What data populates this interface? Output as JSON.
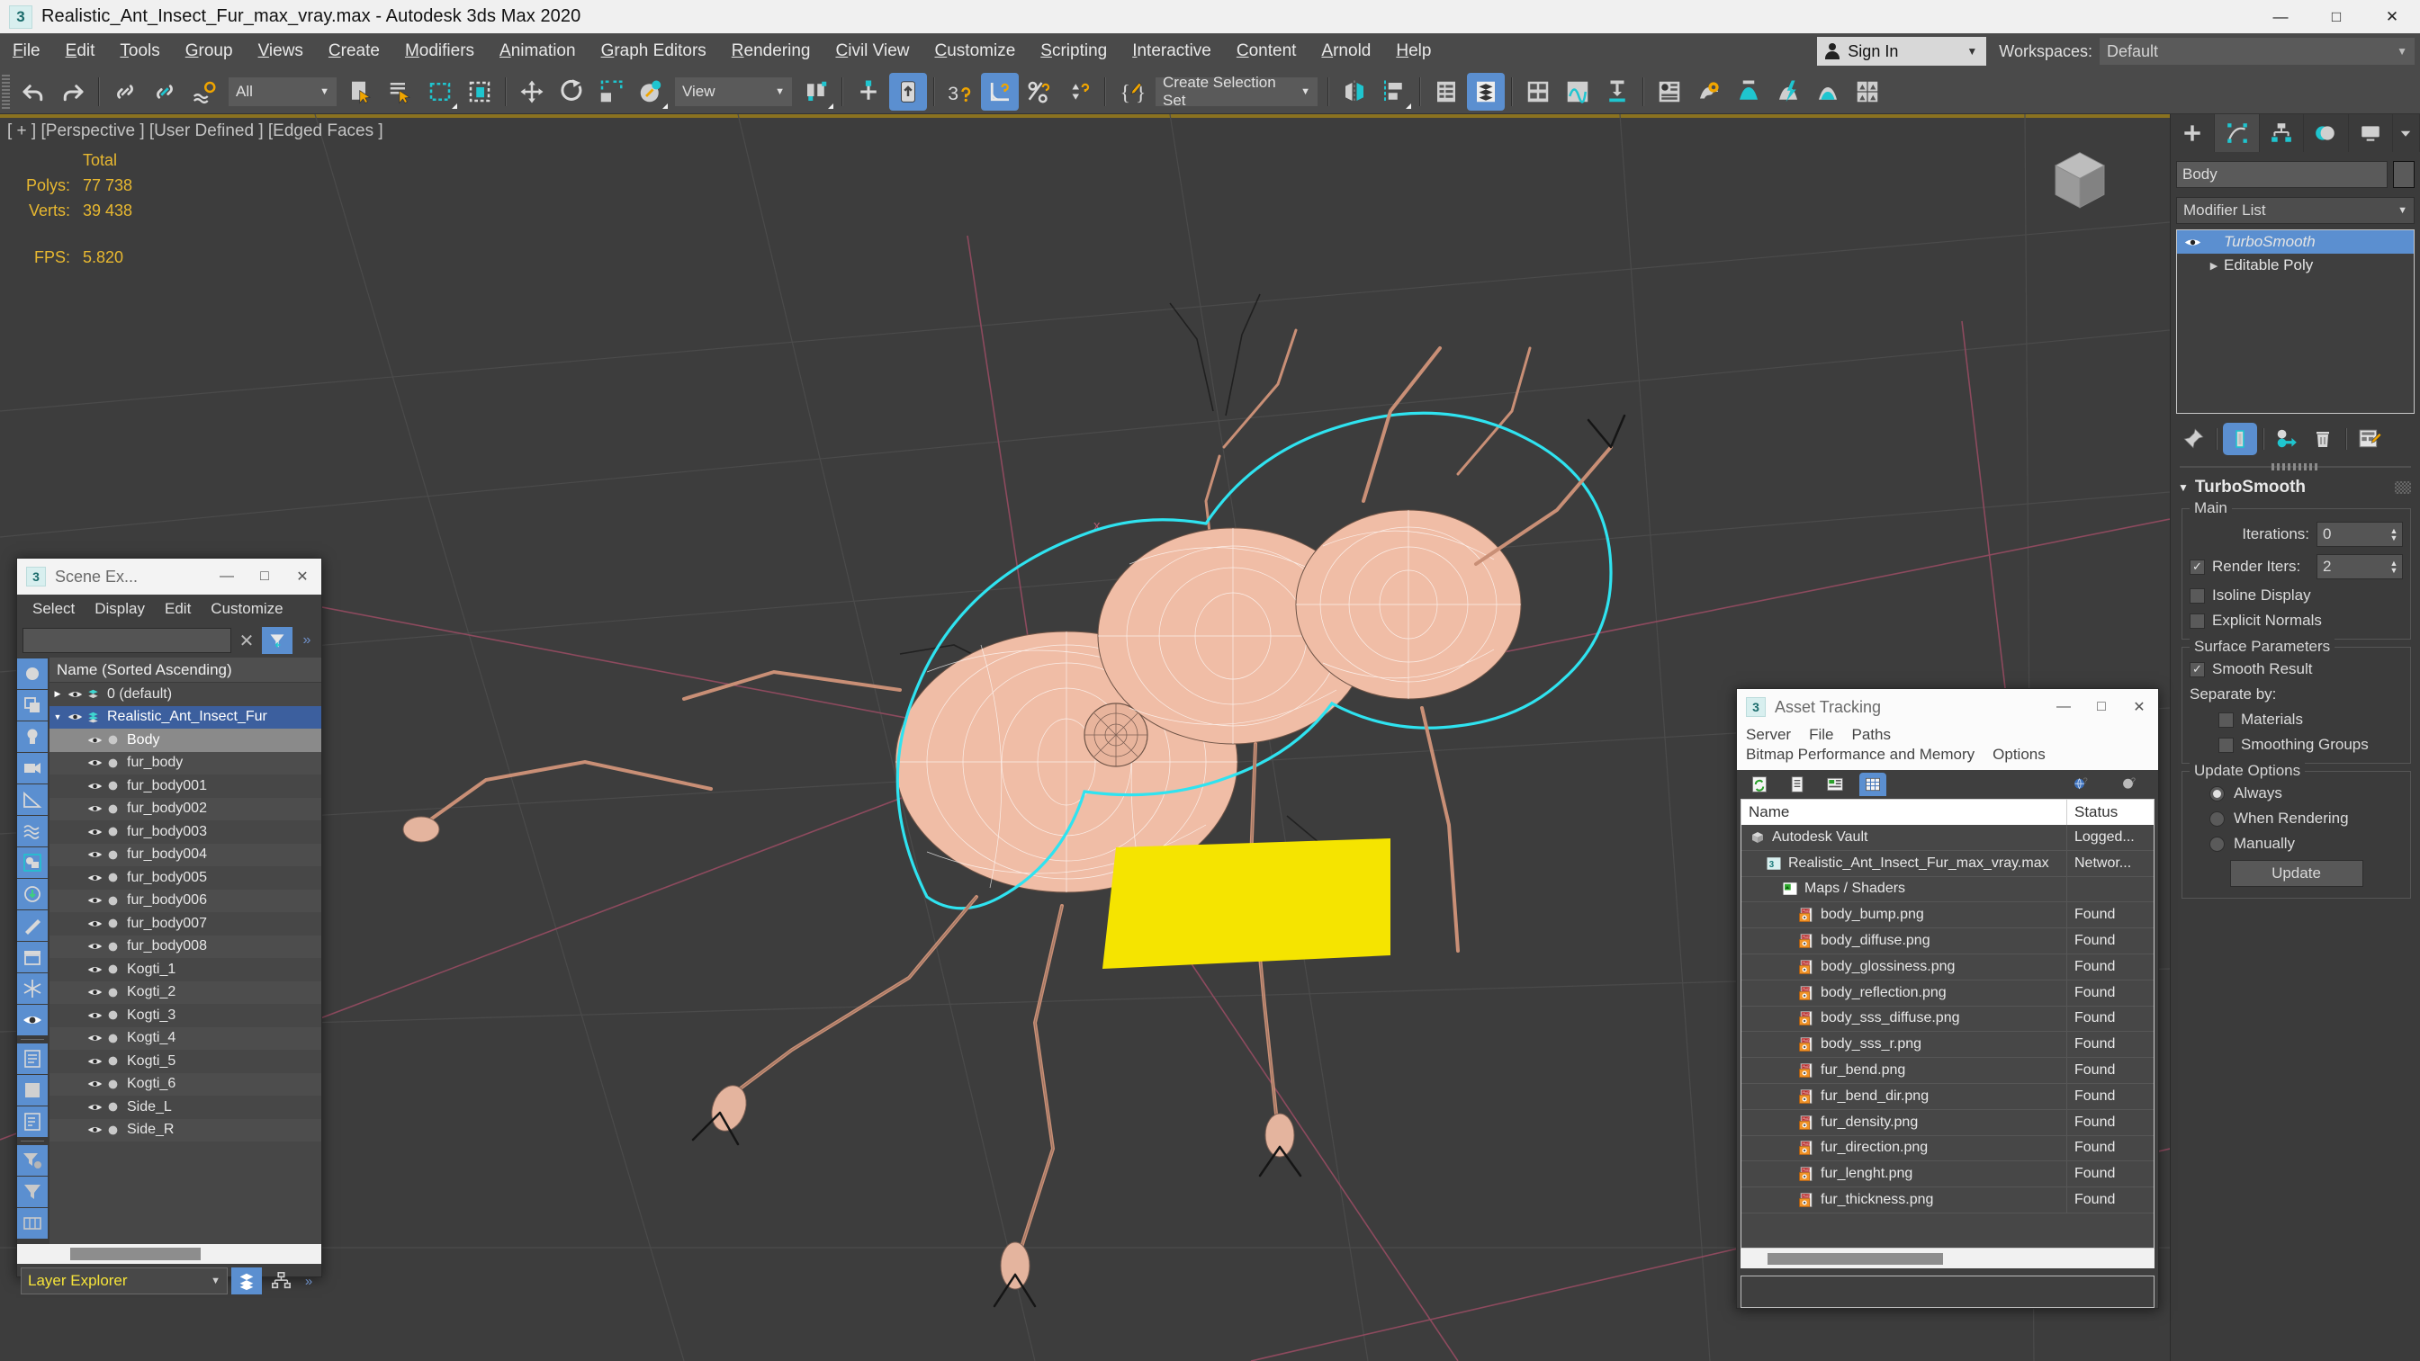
{
  "window": {
    "title": "Realistic_Ant_Insect_Fur_max_vray.max - Autodesk 3ds Max 2020",
    "app_icon": "3dsmax-icon",
    "minimize": "—",
    "maximize": "□",
    "close": "✕"
  },
  "menubar": {
    "items": [
      "File",
      "Edit",
      "Tools",
      "Group",
      "Views",
      "Create",
      "Modifiers",
      "Animation",
      "Graph Editors",
      "Rendering",
      "Civil View",
      "Customize",
      "Scripting",
      "Interactive",
      "Content",
      "Arnold",
      "Help"
    ],
    "sign_in": "Sign In",
    "workspaces_label": "Workspaces:",
    "workspace_value": "Default"
  },
  "toolbar": {
    "selection_filter": "All",
    "reference_coord": "View",
    "selection_set": "Create Selection Set",
    "buttons": [
      "undo",
      "redo",
      "select-link",
      "unlink",
      "bind-spacewarp",
      "selection-filter",
      "select-object",
      "select-by-name",
      "select-region",
      "window-crossing",
      "select-and-move",
      "select-and-rotate",
      "select-and-scale",
      "reference-coordinate",
      "use-pivot-center",
      "snap-toggle",
      "angle-snap",
      "percent-snap",
      "spinner-snap",
      "named-selection-sets",
      "mirror",
      "align",
      "layer-explorer",
      "scene-explorer",
      "curve-editor",
      "schematic-view",
      "render-setup",
      "render-frame-window",
      "render-production",
      "render-iterative",
      "render-in-cloud",
      "material-editor"
    ]
  },
  "viewport": {
    "label": "[ + ] [Perspective ] [User Defined ] [Edged Faces ]",
    "stats": {
      "header": "Total",
      "polys_label": "Polys:",
      "polys_value": "77 738",
      "verts_label": "Verts:",
      "verts_value": "39 438",
      "fps_label": "FPS:",
      "fps_value": "5.820"
    }
  },
  "scene_explorer": {
    "title": "Scene Ex...",
    "menu": [
      "Select",
      "Display",
      "Edit",
      "Customize"
    ],
    "search_value": "",
    "column_header": "Name (Sorted Ascending)",
    "rows": [
      {
        "name": "0 (default)",
        "indent": 0,
        "twisty": "▶",
        "type": "layer",
        "state": "normal"
      },
      {
        "name": "Realistic_Ant_Insect_Fur",
        "indent": 0,
        "twisty": "▼",
        "type": "layer",
        "state": "selected"
      },
      {
        "name": "Body",
        "indent": 1,
        "twisty": "",
        "type": "object",
        "state": "highlight"
      },
      {
        "name": "fur_body",
        "indent": 1,
        "twisty": "",
        "type": "object",
        "state": "normal"
      },
      {
        "name": "fur_body001",
        "indent": 1,
        "twisty": "",
        "type": "object",
        "state": "normal"
      },
      {
        "name": "fur_body002",
        "indent": 1,
        "twisty": "",
        "type": "object",
        "state": "normal"
      },
      {
        "name": "fur_body003",
        "indent": 1,
        "twisty": "",
        "type": "object",
        "state": "normal"
      },
      {
        "name": "fur_body004",
        "indent": 1,
        "twisty": "",
        "type": "object",
        "state": "normal"
      },
      {
        "name": "fur_body005",
        "indent": 1,
        "twisty": "",
        "type": "object",
        "state": "normal"
      },
      {
        "name": "fur_body006",
        "indent": 1,
        "twisty": "",
        "type": "object",
        "state": "normal"
      },
      {
        "name": "fur_body007",
        "indent": 1,
        "twisty": "",
        "type": "object",
        "state": "normal"
      },
      {
        "name": "fur_body008",
        "indent": 1,
        "twisty": "",
        "type": "object",
        "state": "normal"
      },
      {
        "name": "Kogti_1",
        "indent": 1,
        "twisty": "",
        "type": "object",
        "state": "normal"
      },
      {
        "name": "Kogti_2",
        "indent": 1,
        "twisty": "",
        "type": "object",
        "state": "normal"
      },
      {
        "name": "Kogti_3",
        "indent": 1,
        "twisty": "",
        "type": "object",
        "state": "normal"
      },
      {
        "name": "Kogti_4",
        "indent": 1,
        "twisty": "",
        "type": "object",
        "state": "normal"
      },
      {
        "name": "Kogti_5",
        "indent": 1,
        "twisty": "",
        "type": "object",
        "state": "normal"
      },
      {
        "name": "Kogti_6",
        "indent": 1,
        "twisty": "",
        "type": "object",
        "state": "normal"
      },
      {
        "name": "Side_L",
        "indent": 1,
        "twisty": "",
        "type": "object",
        "state": "normal"
      },
      {
        "name": "Side_R",
        "indent": 1,
        "twisty": "",
        "type": "object",
        "state": "normal"
      }
    ],
    "footer_mode": "Layer Explorer"
  },
  "asset_tracking": {
    "title": "Asset Tracking",
    "menu_row1": [
      "Server",
      "File",
      "Paths"
    ],
    "menu_row2": [
      "Bitmap Performance and Memory",
      "Options"
    ],
    "columns": [
      "Name",
      "Status"
    ],
    "rows": [
      {
        "name": "Autodesk Vault",
        "status": "Logged...",
        "indent": 0,
        "icon": "vault-icon"
      },
      {
        "name": "Realistic_Ant_Insect_Fur_max_vray.max",
        "status": "Networ...",
        "indent": 1,
        "icon": "max-file-icon"
      },
      {
        "name": "Maps / Shaders",
        "status": "",
        "indent": 2,
        "icon": "maps-icon"
      },
      {
        "name": "body_bump.png",
        "status": "Found",
        "indent": 3,
        "icon": "png-icon"
      },
      {
        "name": "body_diffuse.png",
        "status": "Found",
        "indent": 3,
        "icon": "png-icon"
      },
      {
        "name": "body_glossiness.png",
        "status": "Found",
        "indent": 3,
        "icon": "png-icon"
      },
      {
        "name": "body_reflection.png",
        "status": "Found",
        "indent": 3,
        "icon": "png-icon"
      },
      {
        "name": "body_sss_diffuse.png",
        "status": "Found",
        "indent": 3,
        "icon": "png-icon"
      },
      {
        "name": "body_sss_r.png",
        "status": "Found",
        "indent": 3,
        "icon": "png-icon"
      },
      {
        "name": "fur_bend.png",
        "status": "Found",
        "indent": 3,
        "icon": "png-icon"
      },
      {
        "name": "fur_bend_dir.png",
        "status": "Found",
        "indent": 3,
        "icon": "png-icon"
      },
      {
        "name": "fur_density.png",
        "status": "Found",
        "indent": 3,
        "icon": "png-icon"
      },
      {
        "name": "fur_direction.png",
        "status": "Found",
        "indent": 3,
        "icon": "png-icon"
      },
      {
        "name": "fur_lenght.png",
        "status": "Found",
        "indent": 3,
        "icon": "png-icon"
      },
      {
        "name": "fur_thickness.png",
        "status": "Found",
        "indent": 3,
        "icon": "png-icon"
      }
    ]
  },
  "command_panel": {
    "tabs": [
      "create",
      "modify",
      "hierarchy",
      "motion",
      "display",
      "utilities"
    ],
    "object_name": "Body",
    "modifier_list_label": "Modifier List",
    "stack": [
      {
        "label": "TurboSmooth",
        "selected": true,
        "eye": true
      },
      {
        "label": "Editable Poly",
        "selected": false,
        "eye": false,
        "twisty": "▶"
      }
    ],
    "rollout": {
      "title": "TurboSmooth",
      "main_label": "Main",
      "iterations_label": "Iterations:",
      "iterations_value": "0",
      "render_iters_label": "Render Iters:",
      "render_iters_value": "2",
      "render_iters_checked": true,
      "isoline_label": "Isoline Display",
      "isoline_checked": false,
      "explicit_label": "Explicit Normals",
      "explicit_checked": false,
      "surface_label": "Surface Parameters",
      "smooth_result_label": "Smooth Result",
      "smooth_result_checked": true,
      "separate_label": "Separate by:",
      "materials_label": "Materials",
      "materials_checked": false,
      "smoothing_groups_label": "Smoothing Groups",
      "smoothing_groups_checked": false,
      "update_options_label": "Update Options",
      "always_label": "Always",
      "when_rendering_label": "When Rendering",
      "manually_label": "Manually",
      "update_selected": "Always",
      "update_button": "Update"
    }
  },
  "colors": {
    "accent_blue": "#5b8fd0",
    "viewport_bg": "#3d3d3d",
    "panel_bg": "#3b3b3b",
    "stat_yellow": "#e8b830",
    "selection_cyan": "#2fe3f0",
    "plane_yellow": "#f5e400",
    "mesh_pink": "#f0bda6"
  }
}
